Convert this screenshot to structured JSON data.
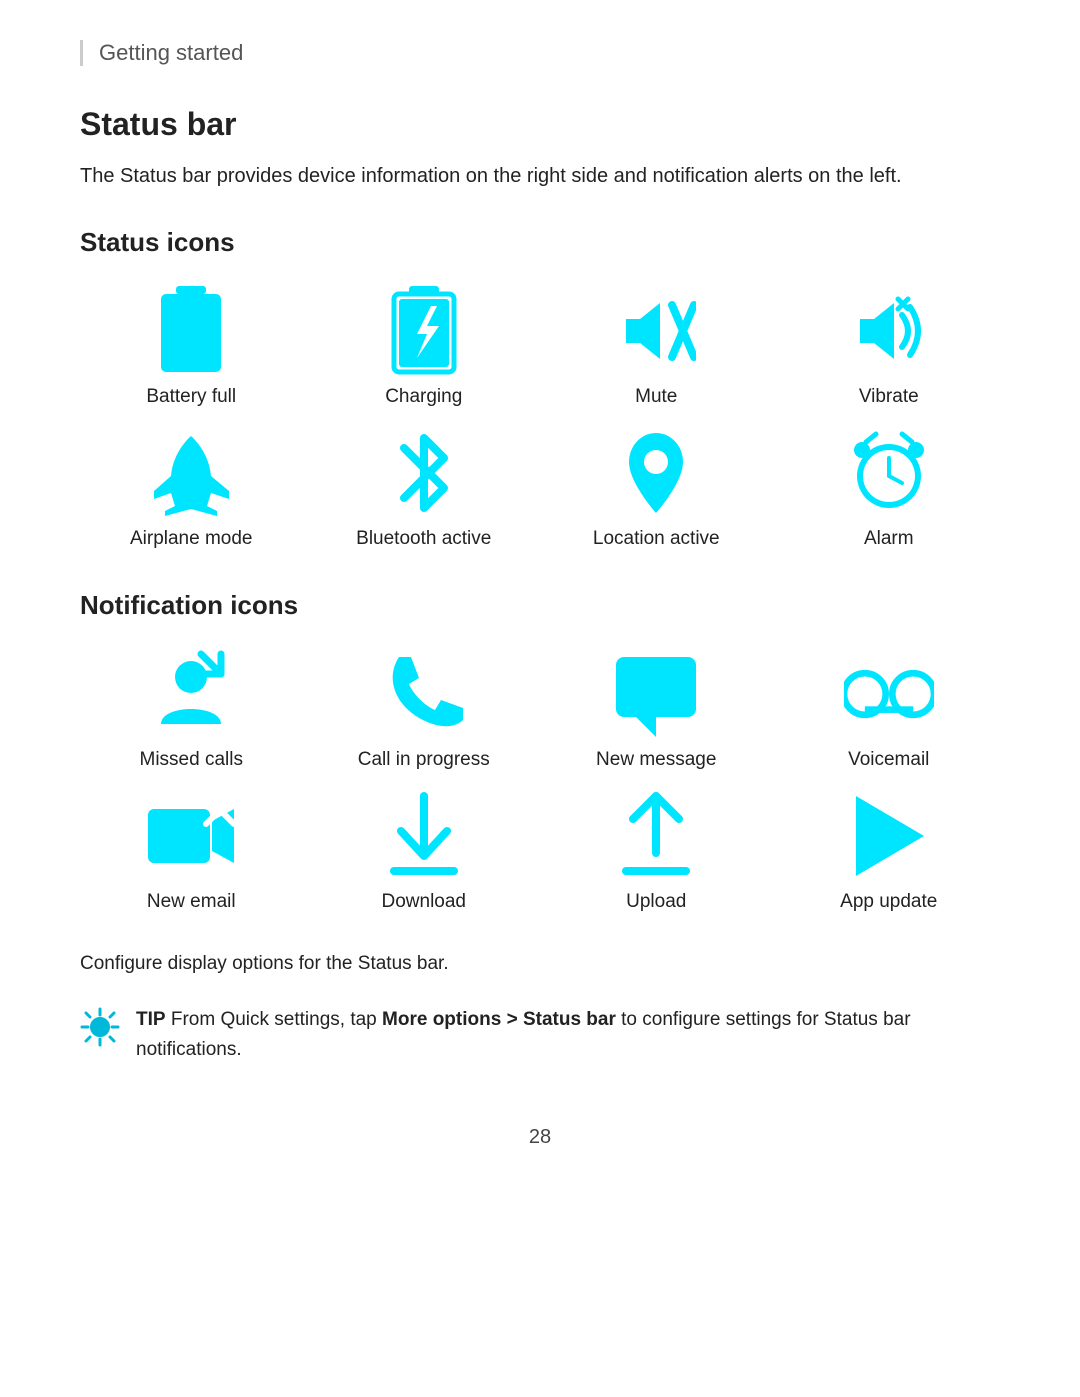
{
  "breadcrumb": "Getting started",
  "section": {
    "title": "Status bar",
    "description": "The Status bar provides device information on the right side and notification alerts on the left."
  },
  "status_icons": {
    "title": "Status icons",
    "items": [
      {
        "label": "Battery full",
        "name": "battery-full-icon"
      },
      {
        "label": "Charging",
        "name": "charging-icon"
      },
      {
        "label": "Mute",
        "name": "mute-icon"
      },
      {
        "label": "Vibrate",
        "name": "vibrate-icon"
      },
      {
        "label": "Airplane mode",
        "name": "airplane-mode-icon"
      },
      {
        "label": "Bluetooth active",
        "name": "bluetooth-active-icon"
      },
      {
        "label": "Location active",
        "name": "location-active-icon"
      },
      {
        "label": "Alarm",
        "name": "alarm-icon"
      }
    ]
  },
  "notification_icons": {
    "title": "Notification icons",
    "items": [
      {
        "label": "Missed calls",
        "name": "missed-calls-icon"
      },
      {
        "label": "Call in progress",
        "name": "call-in-progress-icon"
      },
      {
        "label": "New message",
        "name": "new-message-icon"
      },
      {
        "label": "Voicemail",
        "name": "voicemail-icon"
      },
      {
        "label": "New email",
        "name": "new-email-icon"
      },
      {
        "label": "Download",
        "name": "download-icon"
      },
      {
        "label": "Upload",
        "name": "upload-icon"
      },
      {
        "label": "App update",
        "name": "app-update-icon"
      }
    ]
  },
  "configure_text": "Configure display options for the Status bar.",
  "tip": {
    "prefix": "TIP",
    "text": " From Quick settings, tap ",
    "bold_part": "More options > Status bar",
    "suffix": " to configure settings for Status bar notifications."
  },
  "page_number": "28"
}
